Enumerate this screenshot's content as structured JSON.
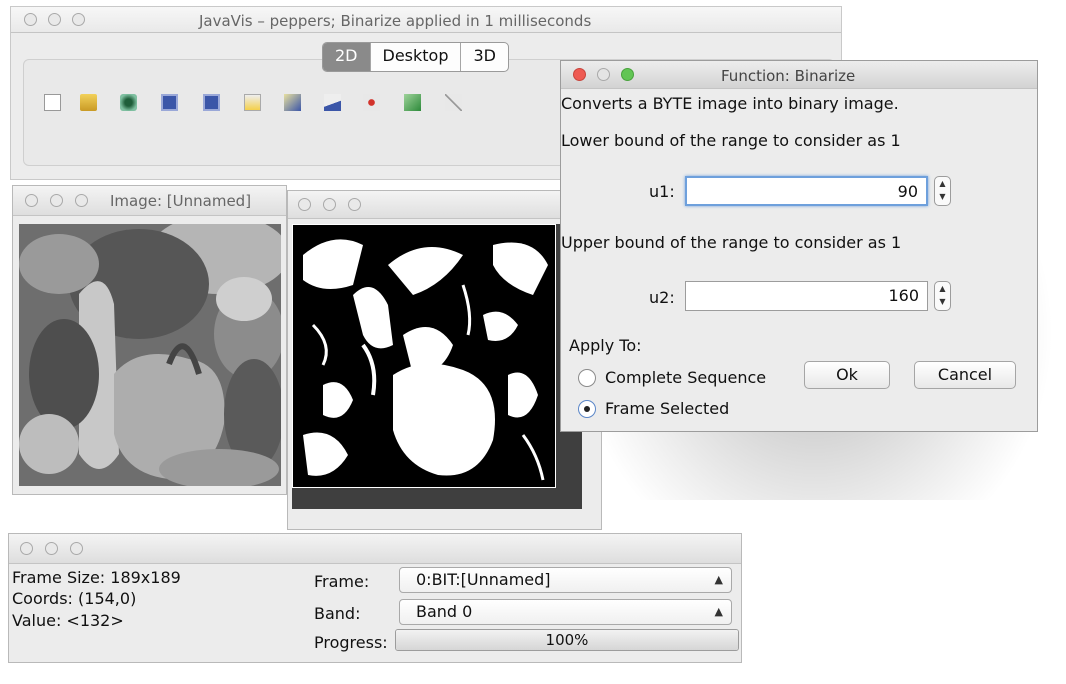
{
  "main_window": {
    "title": "JavaVis – peppers; Binarize applied in 1 milliseconds",
    "tabs": [
      "2D",
      "Desktop",
      "3D"
    ],
    "selected_tab": "2D",
    "toolbar_icons": [
      "new-file-icon",
      "open-folder-icon",
      "capture-icon",
      "save-icon",
      "save-as-icon",
      "paint-icon",
      "image-edit-icon",
      "draw-icon",
      "point-icon",
      "cube-icon",
      "line-icon"
    ]
  },
  "image_window": {
    "title": "Image: [Unnamed]"
  },
  "binary_window": {
    "title": ""
  },
  "dialog": {
    "title": "Function: Binarize",
    "description": "Converts a BYTE image into binary image.",
    "lower_label": "Lower bound of the range to consider as 1",
    "u1_label": "u1:",
    "u1_value": "90",
    "upper_label": "Upper bound of the range to consider as 1",
    "u2_label": "u2:",
    "u2_value": "160",
    "apply_to_label": "Apply To:",
    "option_complete": "Complete Sequence",
    "option_frame": "Frame Selected",
    "selected_option": "Frame Selected",
    "ok_label": "Ok",
    "cancel_label": "Cancel"
  },
  "info_panel": {
    "frame_size": "Frame Size: 189x189",
    "coords": "Coords: (154,0)",
    "value": "Value: <132>",
    "frame_label": "Frame:",
    "frame_value": "0:BIT:[Unnamed]",
    "band_label": "Band:",
    "band_value": "Band 0",
    "progress_label": "Progress:",
    "progress_text": "100%",
    "progress_fraction": 1.0
  },
  "colors": {
    "close": "#ee5a52",
    "minimize": "#f5bf4f",
    "zoom": "#62c554",
    "focus": "#6ea0dc",
    "selected_tab": "#8a8a8a"
  }
}
